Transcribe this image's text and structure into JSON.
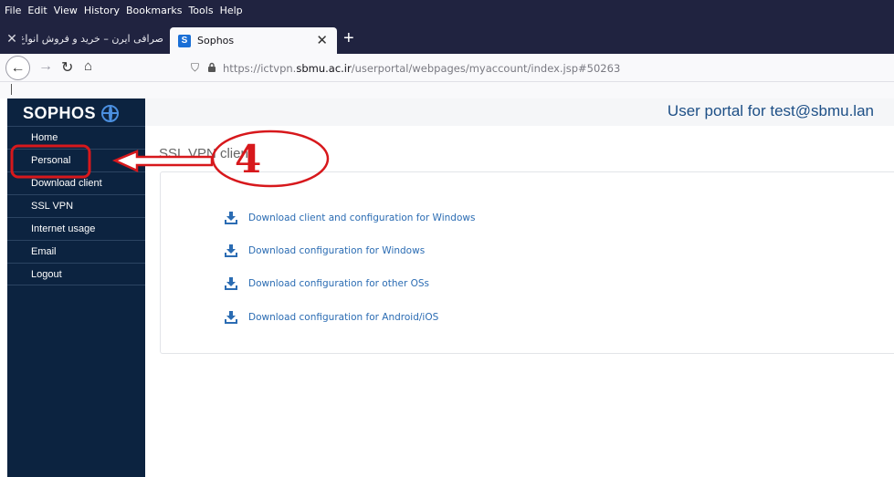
{
  "browser": {
    "menu": [
      "File",
      "Edit",
      "View",
      "History",
      "Bookmarks",
      "Tools",
      "Help"
    ],
    "tabs": [
      {
        "title": "صرافی ایرن – خرید و فروش انواع ارز دیجیتال",
        "active": false
      },
      {
        "title": "Sophos",
        "active": true,
        "favicon": "S"
      }
    ],
    "new_tab_label": "+",
    "url": {
      "prefix": "https://ictvpn.",
      "domain": "sbmu.ac.ir",
      "suffix": "/userportal/webpages/myaccount/index.jsp#50263"
    },
    "icons": [
      "back-icon",
      "forward-icon",
      "reload-icon",
      "home-icon",
      "shield-icon",
      "lock-icon",
      "close-icon"
    ]
  },
  "portal": {
    "logo_text": "SOPHOS",
    "title": "User portal for test@sbmu.lan",
    "sidebar": [
      {
        "label": "Home"
      },
      {
        "label": "Personal"
      },
      {
        "label": "Download client"
      },
      {
        "label": "SSL VPN"
      },
      {
        "label": "Internet usage"
      },
      {
        "label": "Email"
      },
      {
        "label": "Logout"
      }
    ],
    "section_title": "SSL VPN client",
    "downloads": [
      {
        "label": "Download client and configuration for Windows"
      },
      {
        "label": "Download configuration for Windows"
      },
      {
        "label": "Download configuration for other OSs"
      },
      {
        "label": "Download configuration for Android/iOS"
      }
    ],
    "colors": {
      "sidebar": "#0c2340",
      "title": "#1d4f86",
      "link": "#2b6cb3",
      "annotation": "#d7181c"
    }
  },
  "annotation": {
    "number": "4"
  }
}
